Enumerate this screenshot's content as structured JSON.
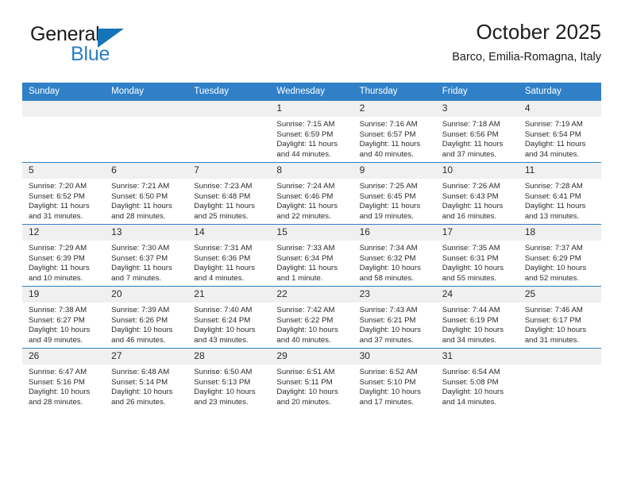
{
  "brand": {
    "word_one": "General",
    "word_two": "Blue",
    "triangle_color": "#1574b8",
    "blue_text_color": "#2b7fc4"
  },
  "header": {
    "title": "October 2025",
    "subtitle": "Barco, Emilia-Romagna, Italy"
  },
  "theme": {
    "header_bg": "#3080c8",
    "daynum_bg": "#f0f0f0",
    "grid_line": "#3080c8"
  },
  "calendar": {
    "weekday_headers": [
      "Sunday",
      "Monday",
      "Tuesday",
      "Wednesday",
      "Thursday",
      "Friday",
      "Saturday"
    ],
    "weeks": [
      [
        {
          "day": "",
          "empty": true,
          "sunrise": "",
          "sunset": "",
          "daylight_line1": "",
          "daylight_line2": ""
        },
        {
          "day": "",
          "empty": true,
          "sunrise": "",
          "sunset": "",
          "daylight_line1": "",
          "daylight_line2": ""
        },
        {
          "day": "",
          "empty": true,
          "sunrise": "",
          "sunset": "",
          "daylight_line1": "",
          "daylight_line2": ""
        },
        {
          "day": "1",
          "empty": false,
          "sunrise": "Sunrise: 7:15 AM",
          "sunset": "Sunset: 6:59 PM",
          "daylight_line1": "Daylight: 11 hours",
          "daylight_line2": "and 44 minutes."
        },
        {
          "day": "2",
          "empty": false,
          "sunrise": "Sunrise: 7:16 AM",
          "sunset": "Sunset: 6:57 PM",
          "daylight_line1": "Daylight: 11 hours",
          "daylight_line2": "and 40 minutes."
        },
        {
          "day": "3",
          "empty": false,
          "sunrise": "Sunrise: 7:18 AM",
          "sunset": "Sunset: 6:56 PM",
          "daylight_line1": "Daylight: 11 hours",
          "daylight_line2": "and 37 minutes."
        },
        {
          "day": "4",
          "empty": false,
          "sunrise": "Sunrise: 7:19 AM",
          "sunset": "Sunset: 6:54 PM",
          "daylight_line1": "Daylight: 11 hours",
          "daylight_line2": "and 34 minutes."
        }
      ],
      [
        {
          "day": "5",
          "empty": false,
          "sunrise": "Sunrise: 7:20 AM",
          "sunset": "Sunset: 6:52 PM",
          "daylight_line1": "Daylight: 11 hours",
          "daylight_line2": "and 31 minutes."
        },
        {
          "day": "6",
          "empty": false,
          "sunrise": "Sunrise: 7:21 AM",
          "sunset": "Sunset: 6:50 PM",
          "daylight_line1": "Daylight: 11 hours",
          "daylight_line2": "and 28 minutes."
        },
        {
          "day": "7",
          "empty": false,
          "sunrise": "Sunrise: 7:23 AM",
          "sunset": "Sunset: 6:48 PM",
          "daylight_line1": "Daylight: 11 hours",
          "daylight_line2": "and 25 minutes."
        },
        {
          "day": "8",
          "empty": false,
          "sunrise": "Sunrise: 7:24 AM",
          "sunset": "Sunset: 6:46 PM",
          "daylight_line1": "Daylight: 11 hours",
          "daylight_line2": "and 22 minutes."
        },
        {
          "day": "9",
          "empty": false,
          "sunrise": "Sunrise: 7:25 AM",
          "sunset": "Sunset: 6:45 PM",
          "daylight_line1": "Daylight: 11 hours",
          "daylight_line2": "and 19 minutes."
        },
        {
          "day": "10",
          "empty": false,
          "sunrise": "Sunrise: 7:26 AM",
          "sunset": "Sunset: 6:43 PM",
          "daylight_line1": "Daylight: 11 hours",
          "daylight_line2": "and 16 minutes."
        },
        {
          "day": "11",
          "empty": false,
          "sunrise": "Sunrise: 7:28 AM",
          "sunset": "Sunset: 6:41 PM",
          "daylight_line1": "Daylight: 11 hours",
          "daylight_line2": "and 13 minutes."
        }
      ],
      [
        {
          "day": "12",
          "empty": false,
          "sunrise": "Sunrise: 7:29 AM",
          "sunset": "Sunset: 6:39 PM",
          "daylight_line1": "Daylight: 11 hours",
          "daylight_line2": "and 10 minutes."
        },
        {
          "day": "13",
          "empty": false,
          "sunrise": "Sunrise: 7:30 AM",
          "sunset": "Sunset: 6:37 PM",
          "daylight_line1": "Daylight: 11 hours",
          "daylight_line2": "and 7 minutes."
        },
        {
          "day": "14",
          "empty": false,
          "sunrise": "Sunrise: 7:31 AM",
          "sunset": "Sunset: 6:36 PM",
          "daylight_line1": "Daylight: 11 hours",
          "daylight_line2": "and 4 minutes."
        },
        {
          "day": "15",
          "empty": false,
          "sunrise": "Sunrise: 7:33 AM",
          "sunset": "Sunset: 6:34 PM",
          "daylight_line1": "Daylight: 11 hours",
          "daylight_line2": "and 1 minute."
        },
        {
          "day": "16",
          "empty": false,
          "sunrise": "Sunrise: 7:34 AM",
          "sunset": "Sunset: 6:32 PM",
          "daylight_line1": "Daylight: 10 hours",
          "daylight_line2": "and 58 minutes."
        },
        {
          "day": "17",
          "empty": false,
          "sunrise": "Sunrise: 7:35 AM",
          "sunset": "Sunset: 6:31 PM",
          "daylight_line1": "Daylight: 10 hours",
          "daylight_line2": "and 55 minutes."
        },
        {
          "day": "18",
          "empty": false,
          "sunrise": "Sunrise: 7:37 AM",
          "sunset": "Sunset: 6:29 PM",
          "daylight_line1": "Daylight: 10 hours",
          "daylight_line2": "and 52 minutes."
        }
      ],
      [
        {
          "day": "19",
          "empty": false,
          "sunrise": "Sunrise: 7:38 AM",
          "sunset": "Sunset: 6:27 PM",
          "daylight_line1": "Daylight: 10 hours",
          "daylight_line2": "and 49 minutes."
        },
        {
          "day": "20",
          "empty": false,
          "sunrise": "Sunrise: 7:39 AM",
          "sunset": "Sunset: 6:26 PM",
          "daylight_line1": "Daylight: 10 hours",
          "daylight_line2": "and 46 minutes."
        },
        {
          "day": "21",
          "empty": false,
          "sunrise": "Sunrise: 7:40 AM",
          "sunset": "Sunset: 6:24 PM",
          "daylight_line1": "Daylight: 10 hours",
          "daylight_line2": "and 43 minutes."
        },
        {
          "day": "22",
          "empty": false,
          "sunrise": "Sunrise: 7:42 AM",
          "sunset": "Sunset: 6:22 PM",
          "daylight_line1": "Daylight: 10 hours",
          "daylight_line2": "and 40 minutes."
        },
        {
          "day": "23",
          "empty": false,
          "sunrise": "Sunrise: 7:43 AM",
          "sunset": "Sunset: 6:21 PM",
          "daylight_line1": "Daylight: 10 hours",
          "daylight_line2": "and 37 minutes."
        },
        {
          "day": "24",
          "empty": false,
          "sunrise": "Sunrise: 7:44 AM",
          "sunset": "Sunset: 6:19 PM",
          "daylight_line1": "Daylight: 10 hours",
          "daylight_line2": "and 34 minutes."
        },
        {
          "day": "25",
          "empty": false,
          "sunrise": "Sunrise: 7:46 AM",
          "sunset": "Sunset: 6:17 PM",
          "daylight_line1": "Daylight: 10 hours",
          "daylight_line2": "and 31 minutes."
        }
      ],
      [
        {
          "day": "26",
          "empty": false,
          "sunrise": "Sunrise: 6:47 AM",
          "sunset": "Sunset: 5:16 PM",
          "daylight_line1": "Daylight: 10 hours",
          "daylight_line2": "and 28 minutes."
        },
        {
          "day": "27",
          "empty": false,
          "sunrise": "Sunrise: 6:48 AM",
          "sunset": "Sunset: 5:14 PM",
          "daylight_line1": "Daylight: 10 hours",
          "daylight_line2": "and 26 minutes."
        },
        {
          "day": "28",
          "empty": false,
          "sunrise": "Sunrise: 6:50 AM",
          "sunset": "Sunset: 5:13 PM",
          "daylight_line1": "Daylight: 10 hours",
          "daylight_line2": "and 23 minutes."
        },
        {
          "day": "29",
          "empty": false,
          "sunrise": "Sunrise: 6:51 AM",
          "sunset": "Sunset: 5:11 PM",
          "daylight_line1": "Daylight: 10 hours",
          "daylight_line2": "and 20 minutes."
        },
        {
          "day": "30",
          "empty": false,
          "sunrise": "Sunrise: 6:52 AM",
          "sunset": "Sunset: 5:10 PM",
          "daylight_line1": "Daylight: 10 hours",
          "daylight_line2": "and 17 minutes."
        },
        {
          "day": "31",
          "empty": false,
          "sunrise": "Sunrise: 6:54 AM",
          "sunset": "Sunset: 5:08 PM",
          "daylight_line1": "Daylight: 10 hours",
          "daylight_line2": "and 14 minutes."
        },
        {
          "day": "",
          "empty": true,
          "sunrise": "",
          "sunset": "",
          "daylight_line1": "",
          "daylight_line2": ""
        }
      ]
    ]
  }
}
